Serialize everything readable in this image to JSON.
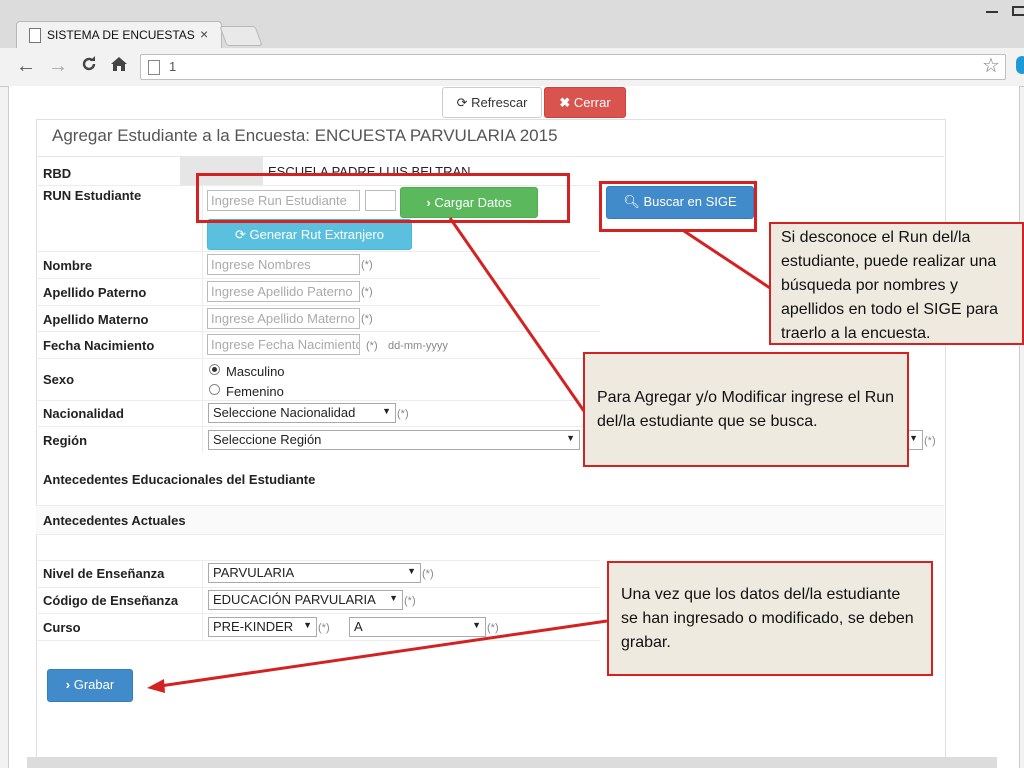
{
  "browser": {
    "tab_title": "SISTEMA DE ENCUESTAS -",
    "tab_close": "×",
    "url": "1"
  },
  "toolbar": {
    "refrescar_label": "Refrescar",
    "cerrar_label": "Cerrar"
  },
  "form": {
    "heading": "Agregar Estudiante a la Encuesta: ENCUESTA PARVULARIA 2015",
    "rbd_label": "RBD",
    "school_name": "ESCUELA PADRE LUIS BELTRAN",
    "run_label": "RUN Estudiante",
    "run_placeholder": "Ingrese Run Estudiante",
    "cargar_label": "Cargar Datos",
    "generar_label": "Generar Rut Extranjero",
    "buscar_label": "Buscar en SIGE",
    "nombre_label": "Nombre",
    "nombre_placeholder": "Ingrese Nombres",
    "apellido_paterno_label": "Apellido Paterno",
    "apellido_paterno_placeholder": "Ingrese Apellido Paterno",
    "apellido_materno_label": "Apellido Materno",
    "apellido_materno_placeholder": "Ingrese Apellido Materno",
    "fecha_label": "Fecha Nacimiento",
    "fecha_placeholder": "Ingrese Fecha Nacimiento",
    "fecha_format": "dd-mm-yyyy",
    "required_mark": "(*)",
    "sexo_label": "Sexo",
    "sexo_options": [
      "Masculino",
      "Femenino"
    ],
    "sexo_selected": "Masculino",
    "nacionalidad_label": "Nacionalidad",
    "nacionalidad_value": "Seleccione Nacionalidad",
    "region_label": "Región",
    "region_value": "Seleccione Región",
    "antecedentes_educacionales": "Antecedentes Educacionales del Estudiante",
    "antecedentes_actuales": "Antecedentes Actuales",
    "nivel_label": "Nivel de Enseñanza",
    "nivel_value": "PARVULARIA",
    "codigo_label": "Código de Enseñanza",
    "codigo_value": "EDUCACIÓN PARVULARIA",
    "curso_label": "Curso",
    "curso_value": "PRE-KINDER",
    "letra_value": "A",
    "grabar_label": "Grabar"
  },
  "callouts": {
    "sige": "Si desconoce el Run del/la estudiante, puede realizar una búsqueda por nombres y apellidos en todo el SIGE para traerlo a la encuesta.",
    "run": "Para Agregar y/o Modificar ingrese el Run del/la  estudiante que se busca.",
    "grabar": "Una vez que los datos del/la estudiante se han ingresado o modificado, se deben grabar."
  },
  "colors": {
    "annotation_red": "#d42121",
    "success_green": "#5cb85c",
    "info_cyan": "#5bc0de",
    "primary_blue": "#428bca",
    "danger_red": "#d9534f"
  }
}
